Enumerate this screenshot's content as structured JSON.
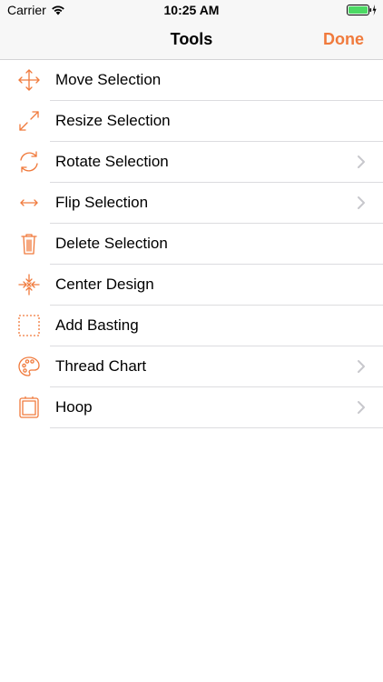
{
  "status": {
    "carrier": "Carrier",
    "time": "10:25 AM"
  },
  "nav": {
    "title": "Tools",
    "done_label": "Done"
  },
  "colors": {
    "accent": "#f07a3c",
    "separator": "#dcdcdf",
    "chevron": "#c7c7cc"
  },
  "items": [
    {
      "label": "Move Selection",
      "icon": "move-icon",
      "has_chevron": false
    },
    {
      "label": "Resize Selection",
      "icon": "resize-icon",
      "has_chevron": false
    },
    {
      "label": "Rotate Selection",
      "icon": "rotate-icon",
      "has_chevron": true
    },
    {
      "label": "Flip Selection",
      "icon": "flip-icon",
      "has_chevron": true
    },
    {
      "label": "Delete Selection",
      "icon": "trash-icon",
      "has_chevron": false
    },
    {
      "label": "Center Design",
      "icon": "center-icon",
      "has_chevron": false
    },
    {
      "label": "Add Basting",
      "icon": "basting-icon",
      "has_chevron": false
    },
    {
      "label": "Thread Chart",
      "icon": "palette-icon",
      "has_chevron": true
    },
    {
      "label": "Hoop",
      "icon": "hoop-icon",
      "has_chevron": true
    }
  ]
}
